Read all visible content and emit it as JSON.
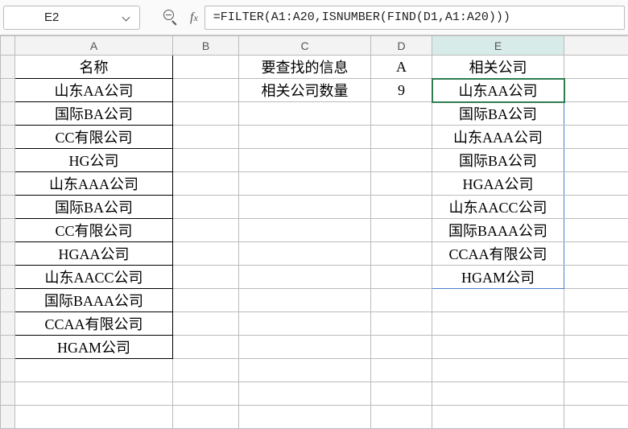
{
  "cellref": "E2",
  "formula": "=FILTER(A1:A20,ISNUMBER(FIND(D1,A1:A20)))",
  "columns": [
    "A",
    "B",
    "C",
    "D",
    "E"
  ],
  "chart_data": {
    "type": "table",
    "title": "",
    "columns_A_header": "名称",
    "columns_A": [
      "山东AA公司",
      "国际BA公司",
      "CC有限公司",
      "HG公司",
      "山东AAA公司",
      "国际BA公司",
      "CC有限公司",
      "HGAA公司",
      "山东AACC公司",
      "国际BAAA公司",
      "CCAA有限公司",
      "HGAM公司"
    ],
    "lookup": {
      "label_info": "要查找的信息",
      "value_info": "A",
      "label_count": "相关公司数量",
      "value_count": 9
    },
    "columns_E_header": "相关公司",
    "columns_E": [
      "山东AA公司",
      "国际BA公司",
      "山东AAA公司",
      "国际BA公司",
      "HGAA公司",
      "山东AACC公司",
      "国际BAAA公司",
      "CCAA有限公司",
      "HGAM公司"
    ]
  }
}
